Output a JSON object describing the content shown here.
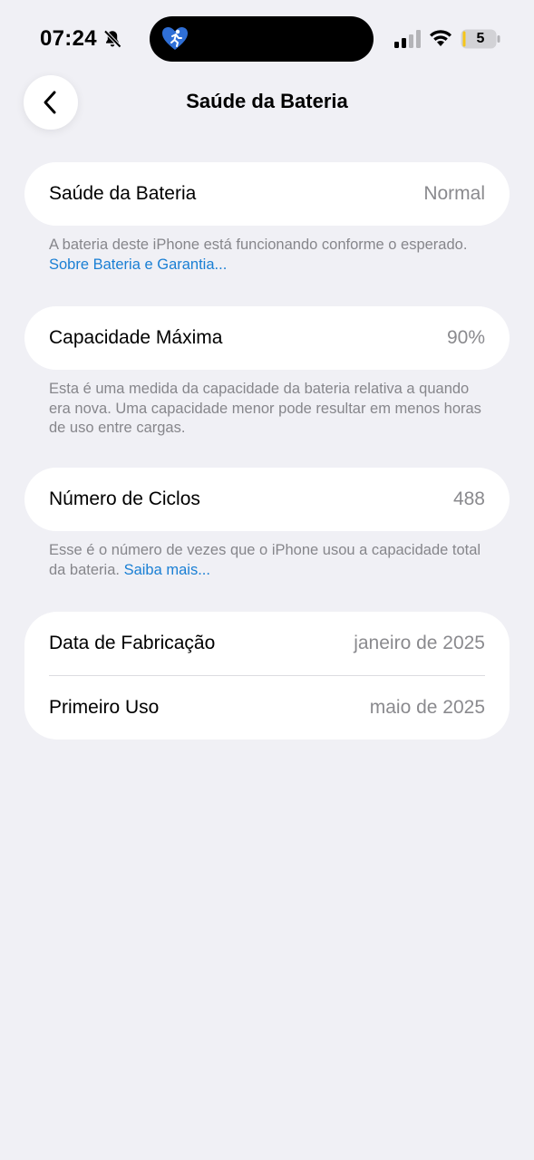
{
  "status_bar": {
    "time": "07:24",
    "battery_level": "5",
    "icons": [
      "bell-slash-icon",
      "fitness-activity-icon",
      "cellular-signal-icon",
      "wifi-icon",
      "battery-icon"
    ]
  },
  "nav": {
    "title": "Saúde da Bateria",
    "back_icon": "chevron-left-icon"
  },
  "sections": {
    "health": {
      "label": "Saúde da Bateria",
      "value": "Normal",
      "footnote": "A bateria deste iPhone está funcionando conforme o esperado.",
      "link": "Sobre Bateria e Garantia..."
    },
    "capacity": {
      "label": "Capacidade Máxima",
      "value": "90%",
      "footnote": "Esta é uma medida da capacidade da bateria relativa a quando era nova. Uma capacidade menor pode resultar em menos horas de uso entre cargas."
    },
    "cycles": {
      "label": "Número de Ciclos",
      "value": "488",
      "footnote": "Esse é o número de vezes que o iPhone usou a capacidade total da bateria.",
      "link": "Saiba mais..."
    },
    "dates": {
      "manufacture_label": "Data de Fabricação",
      "manufacture_value": "janeiro de 2025",
      "first_use_label": "Primeiro Uso",
      "first_use_value": "maio de 2025"
    }
  },
  "colors": {
    "background": "#f0f0f5",
    "card": "#ffffff",
    "secondary_text": "#8a8a8e",
    "link": "#1a7fd4"
  }
}
